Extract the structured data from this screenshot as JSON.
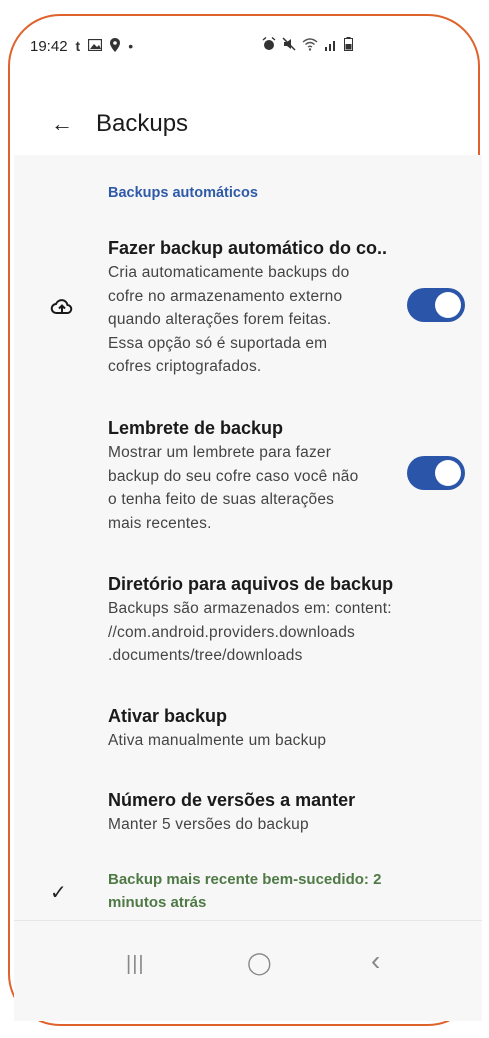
{
  "status_bar": {
    "time": "19:42",
    "left_icons": [
      "t",
      "gallery-icon",
      "location-icon",
      "dot-icon"
    ],
    "right_icons": [
      "alarm-icon",
      "mute-icon",
      "wifi-icon",
      "signal-icon",
      "battery-icon"
    ]
  },
  "app_bar": {
    "title": "Backups"
  },
  "section": {
    "header": "Backups automáticos"
  },
  "items": [
    {
      "title": "Fazer backup automático do co..",
      "description": "Cria automaticamente backups do\ncofre no armazenamento externo\nquando alterações forem feitas.\nEssa opção só é suportada em\ncofres criptografados.",
      "icon": "cloud-upload-icon",
      "toggle_on": true
    },
    {
      "title": "Lembrete de backup",
      "description": "Mostrar um lembrete para fazer\nbackup do seu cofre caso você não\no tenha feito de suas alterações\nmais recentes.",
      "toggle_on": true
    },
    {
      "title": "Diretório para aquivos de backup",
      "description": "Backups são armazenados em: content:\n//com.android.providers.downloads\n.documents/tree/downloads"
    },
    {
      "title": "Ativar backup",
      "description": "Ativa manualmente um backup"
    },
    {
      "title": "Número de versões a manter",
      "description": "Manter 5 versões do backup"
    }
  ],
  "status_message": "Backup mais recente bem-sucedido: 2 minutos atrás",
  "nav": {
    "recents": "|||",
    "home": "◯",
    "back": "‹"
  },
  "colors": {
    "accent": "#2b55a8",
    "section_header": "#2f5aa8",
    "success": "#4f7a45",
    "frame_border": "#e0622b"
  }
}
